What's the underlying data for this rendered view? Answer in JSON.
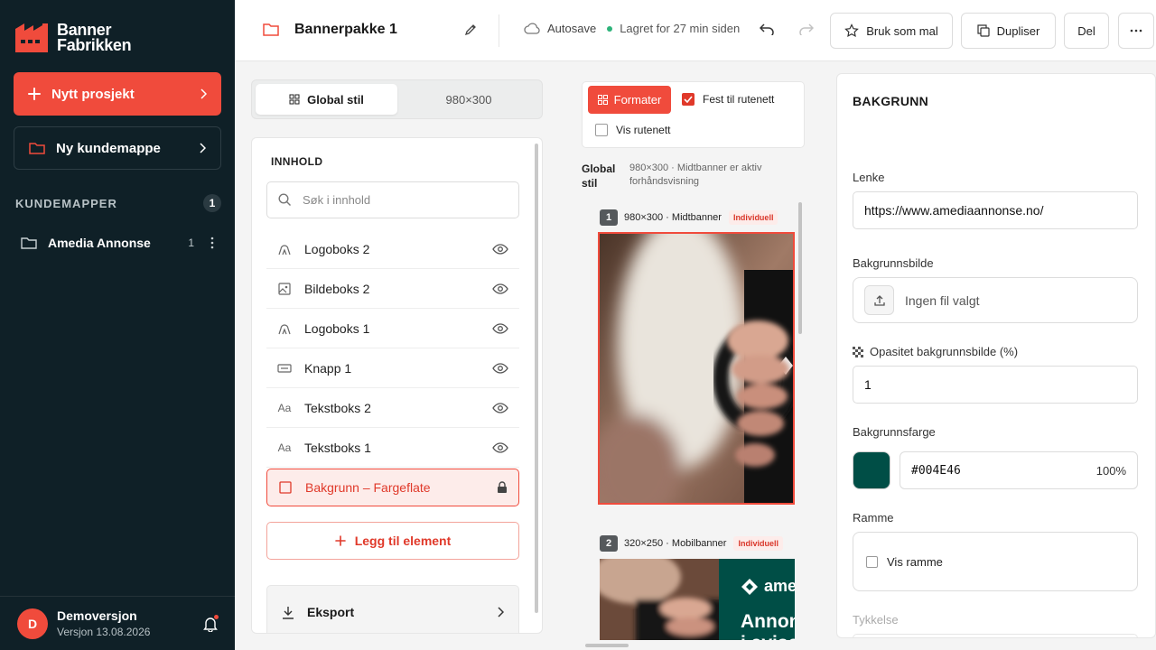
{
  "sidebar": {
    "logo_line1": "Banner",
    "logo_line2": "Fabrikken",
    "new_project": "Nytt prosjekt",
    "new_folder": "Ny kundemappe",
    "section_title": "KUNDEMAPPER",
    "section_count": "1",
    "folders": [
      {
        "label": "Amedia Annonse",
        "count": "1"
      }
    ],
    "user": {
      "initial": "D",
      "name": "Demoversjon",
      "version": "Versjon 13.08.2026"
    }
  },
  "topbar": {
    "title": "Bannerpakke 1",
    "autosave": "Autosave",
    "saved_status": "Lagret for 27 min siden",
    "template_btn": "Bruk som mal",
    "duplicate_btn": "Dupliser",
    "share_btn": "Del"
  },
  "left_panel": {
    "tabs": [
      "Global stil",
      "980×300"
    ],
    "content_title": "INNHOLD",
    "search_placeholder": "Søk i innhold",
    "layers": [
      {
        "icon": "logo-icon",
        "label": "Logoboks 2"
      },
      {
        "icon": "image-icon",
        "label": "Bildeboks 2"
      },
      {
        "icon": "logo-icon",
        "label": "Logoboks 1"
      },
      {
        "icon": "button-icon",
        "label": "Knapp 1"
      },
      {
        "icon": "text-icon",
        "label": "Tekstboks 2",
        "glyph": "Aa"
      },
      {
        "icon": "text-icon",
        "label": "Tekstboks 1",
        "glyph": "Aa"
      },
      {
        "icon": "square-icon",
        "label": "Bakgrunn – Fargeflate",
        "selected": true
      }
    ],
    "add_element": "Legg til element",
    "export": "Eksport"
  },
  "middle": {
    "format_btn": "Formater",
    "snap_label": "Fest til rutenett",
    "snap_checked": true,
    "grid_label": "Vis rutenett",
    "grid_checked": false,
    "global_label": "Global stil",
    "global_info": "980×300 · Midtbanner er aktiv forhåndsvisning",
    "banners": [
      {
        "num": "1",
        "label": "980×300 · Midtbanner",
        "badge": "Individuell"
      },
      {
        "num": "2",
        "label": "320×250 · Mobilbanner",
        "badge": "Individuell",
        "brand": "ame",
        "headline1": "Annon",
        "headline2": "i avise"
      }
    ]
  },
  "right_panel": {
    "title": "BAKGRUNN",
    "link_label": "Lenke",
    "link_value": "https://www.amediaannonse.no/",
    "bgimage_label": "Bakgrunnsbilde",
    "bgimage_value": "Ingen fil valgt",
    "opacity_label": "Opasitet bakgrunnsbilde (%)",
    "opacity_value": "1",
    "bgcolor_label": "Bakgrunnsfarge",
    "bgcolor_hex": "#004E46",
    "bgcolor_opacity": "100%",
    "frame_label": "Ramme",
    "frame_checkbox": "Vis ramme",
    "frame_checked": false,
    "thickness_label": "Tykkelse"
  },
  "colors": {
    "accent": "#f04b3c",
    "sidebar_bg": "#0f2027",
    "bg_color": "#004E46"
  }
}
